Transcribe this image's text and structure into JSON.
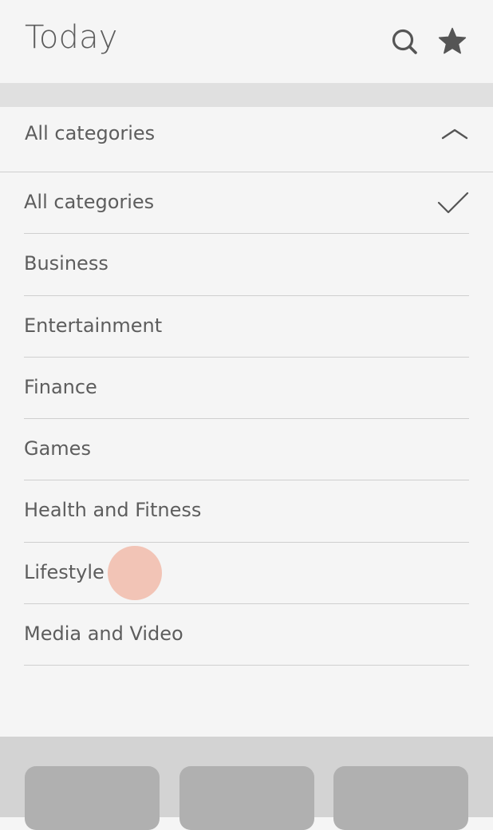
{
  "header": {
    "title": "Today",
    "search_icon": "search-icon",
    "favorite_icon": "star-icon"
  },
  "selector": {
    "label": "All categories",
    "expanded": true,
    "icon": "chevron-up-icon"
  },
  "categories": {
    "items": [
      {
        "label": "All categories",
        "selected": true
      },
      {
        "label": "Business",
        "selected": false
      },
      {
        "label": "Entertainment",
        "selected": false
      },
      {
        "label": "Finance",
        "selected": false
      },
      {
        "label": "Games",
        "selected": false
      },
      {
        "label": "Health and Fitness",
        "selected": false
      },
      {
        "label": "Lifestyle",
        "selected": false
      },
      {
        "label": "Media and Video",
        "selected": false
      }
    ]
  },
  "colors": {
    "background": "#f5f5f5",
    "text": "#5d5d5d",
    "divider": "#cfcfcf",
    "touch_indicator": "#ee9a82",
    "tile": "#b0b0b0"
  }
}
